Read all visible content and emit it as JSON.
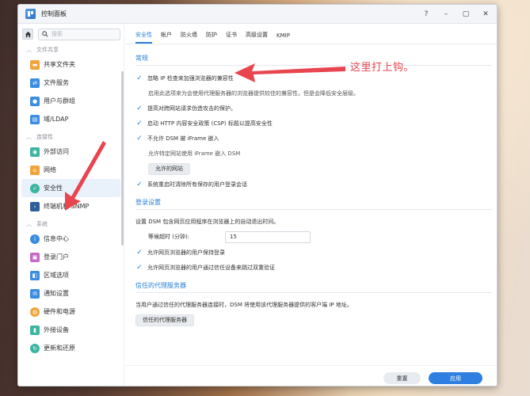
{
  "window": {
    "title": "控制面板",
    "controls": [
      "?",
      "–",
      "▢",
      "✕"
    ]
  },
  "sidebar": {
    "search_placeholder": "搜索",
    "groups": [
      {
        "label": "文件共享",
        "items": [
          {
            "label": "共享文件夹",
            "icon": "shared-folder-icon",
            "color": "#f0a53a"
          },
          {
            "label": "文件服务",
            "icon": "file-services-icon",
            "color": "#3a8de0"
          },
          {
            "label": "用户与群组",
            "icon": "user-group-icon",
            "color": "#3a8de0"
          },
          {
            "label": "域/LDAP",
            "icon": "domain-ldap-icon",
            "color": "#3a8de0"
          }
        ]
      },
      {
        "label": "连接性",
        "items": [
          {
            "label": "外部访问",
            "icon": "external-access-icon",
            "color": "#3ab5a0"
          },
          {
            "label": "网络",
            "icon": "network-icon",
            "color": "#f0a53a"
          },
          {
            "label": "安全性",
            "icon": "shield-icon",
            "color": "#3ab5a0",
            "active": true
          },
          {
            "label": "终端机和 SNMP",
            "icon": "terminal-icon",
            "color": "#2f5f9a"
          }
        ]
      },
      {
        "label": "系统",
        "items": [
          {
            "label": "信息中心",
            "icon": "info-icon",
            "color": "#3a8de0"
          },
          {
            "label": "登录门户",
            "icon": "login-portal-icon",
            "color": "#c46ac4"
          },
          {
            "label": "区域选项",
            "icon": "regional-options-icon",
            "color": "#3a8de0"
          },
          {
            "label": "通知设置",
            "icon": "notification-icon",
            "color": "#3a8de0"
          },
          {
            "label": "硬件和电源",
            "icon": "hardware-power-icon",
            "color": "#f0a53a"
          },
          {
            "label": "外接设备",
            "icon": "external-devices-icon",
            "color": "#3ab5a0"
          },
          {
            "label": "更新和还原",
            "icon": "update-restore-icon",
            "color": "#3ab5a0"
          }
        ]
      }
    ]
  },
  "tabs": [
    "安全性",
    "帐户",
    "防火墙",
    "防护",
    "证书",
    "高级设置",
    "KMIP"
  ],
  "general": {
    "title": "常规",
    "opt1": "忽略 IP 检查来加强浏览器的兼容性",
    "opt1_desc": "启用此选项来为会使用代理服务器的浏览器提供较佳的兼容性，但是会降低安全层级。",
    "opt2": "提高对跨网站请求伪造攻击的保护。",
    "opt3": "启动 HTTP 内容安全政策 (CSP) 标题以提高安全性",
    "opt4": "不允许 DSM 被 iFrame 嵌入",
    "opt4_desc": "允许特定网站使用 iFrame 嵌入 DSM",
    "allowed_sites_btn": "允许的网站",
    "opt5": "系统重启时清除所有保存的用户登录会话"
  },
  "login": {
    "title": "登录设置",
    "desc": "设置 DSM 包含网页应用程序在浏览器上的自动退出时间。",
    "timeout_label": "等候超时 (分钟):",
    "timeout_value": "15",
    "opt1": "允许网页浏览器的用户保持登录",
    "opt2": "允许网页浏览器的用户通过信任设备来跳过双重验证"
  },
  "proxy": {
    "title": "信任的代理服务器",
    "desc": "当用户通过信任的代理服务器连接时，DSM 将使用该代理服务器提供的客户端 IP 地址。",
    "btn": "信任的代理服务器"
  },
  "footer": {
    "reset": "重置",
    "apply": "应用"
  },
  "annotation": {
    "text": "这里打上钩。",
    "color": "#e8454f"
  }
}
